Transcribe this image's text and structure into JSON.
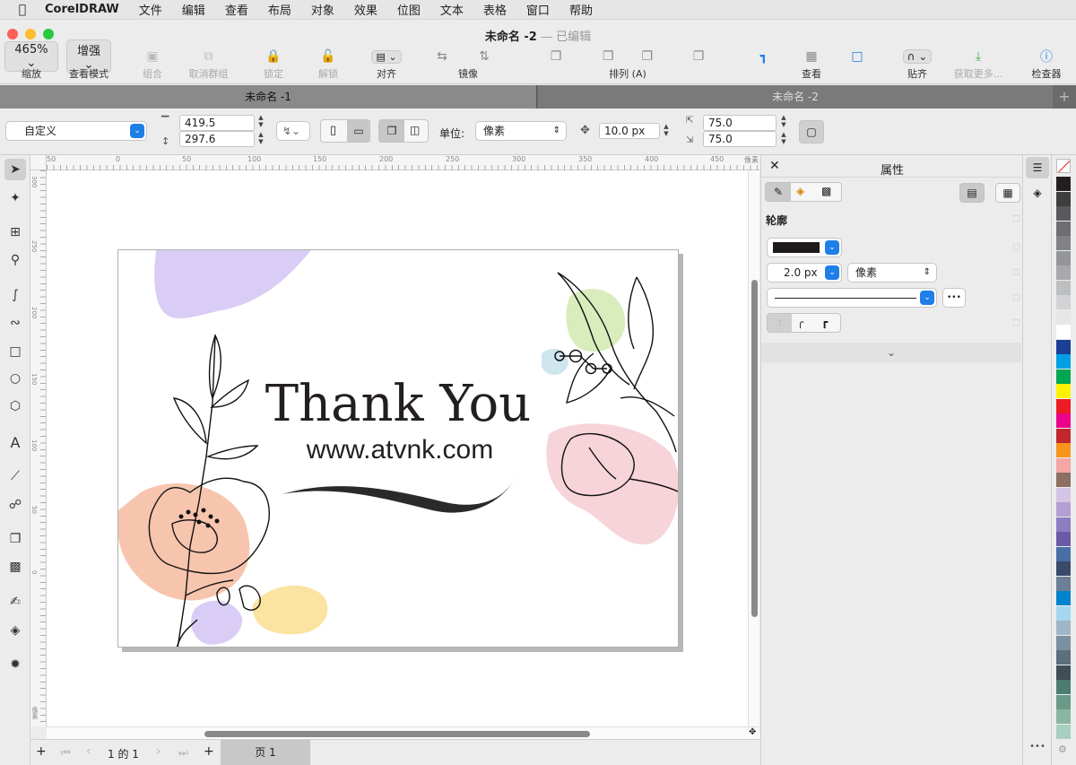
{
  "menubar": {
    "apple_icon": "apple-logo",
    "app_name": "CorelDRAW",
    "items": [
      "文件",
      "编辑",
      "查看",
      "布局",
      "对象",
      "效果",
      "位图",
      "文本",
      "表格",
      "窗口",
      "帮助"
    ]
  },
  "window": {
    "title": "未命名 -2",
    "separator": "—",
    "status": "已编辑"
  },
  "toolbar": {
    "zoom_value": "465%",
    "zoom_label": "缩放",
    "view_mode_value": "增强",
    "view_mode_label": "查看模式",
    "group_label": "组合",
    "ungroup_label": "取消群组",
    "lock_label": "锁定",
    "unlock_label": "解锁",
    "align_label": "对齐",
    "mirror_label": "镜像",
    "arrange_label": "排列 (A)",
    "view_label": "查看",
    "snap_label": "贴齐",
    "more_label": "获取更多...",
    "inspector_label": "检查器"
  },
  "doc_tabs": [
    {
      "label": "未命名 -1",
      "active": true
    },
    {
      "label": "未命名 -2",
      "active": false
    }
  ],
  "property_bar": {
    "page_size": "自定义",
    "width": "419.5",
    "height": "297.6",
    "units_label": "单位:",
    "units_value": "像素",
    "nudge_value": "10.0 px",
    "dup_x": "75.0",
    "dup_y": "75.0"
  },
  "ruler": {
    "top_ticks": [
      "50",
      "0",
      "50",
      "100",
      "150",
      "200",
      "250",
      "300",
      "350",
      "400",
      "450"
    ],
    "top_unit": "像素",
    "left_ticks": [
      "300",
      "250",
      "200",
      "150",
      "100",
      "50",
      "0"
    ],
    "left_unit": "像素"
  },
  "card": {
    "title": "Thank You",
    "url": "www.atvnk.com",
    "colors": {
      "purple": "#d9cdf5",
      "peach": "#f7c4ae",
      "yellow": "#fbe3a1",
      "green": "#d8ecbc",
      "blue": "#cfe6ee",
      "pink": "#f7d4d9"
    }
  },
  "statusbar": {
    "page_counter": "1 的 1",
    "page_tab": "页 1"
  },
  "panel": {
    "title": "属性",
    "section": "轮廓",
    "outline_color": "#1e1a19",
    "width_value": "2.0 px",
    "width_units": "像素",
    "more_button": "•••"
  },
  "palette": [
    "#231f20",
    "#403d3e",
    "#58595b",
    "#6d6e71",
    "#808285",
    "#939598",
    "#a7a9ac",
    "#bcbec0",
    "#d1d3d4",
    "#e6e7e8",
    "#ffffff",
    "#1b3e96",
    "#00a1e4",
    "#00a651",
    "#fff200",
    "#ed1c24",
    "#ec008c",
    "#c1272d",
    "#f7941d",
    "#f4a7a3",
    "#8c6e63",
    "#d4c5e6",
    "#b39fd1",
    "#8e7cc3",
    "#6a5aa8",
    "#4a6fa5",
    "#3b4a6b",
    "#6d7f96",
    "#0083ca",
    "#a7d7f0",
    "#9fb6c6",
    "#7a8fa0",
    "#5b6f7c",
    "#3f4e57",
    "#4c7c6f",
    "#6b9a88",
    "#8bb5a3",
    "#a9cfc0"
  ]
}
